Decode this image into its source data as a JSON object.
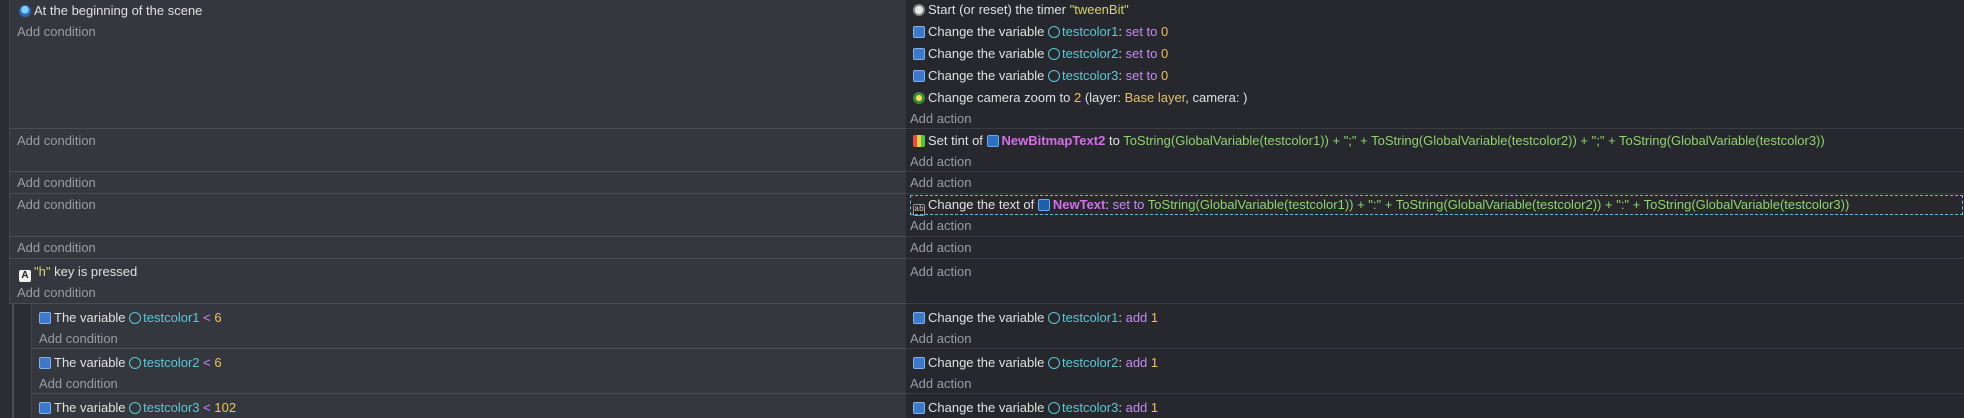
{
  "labels": {
    "add_condition": "Add condition",
    "add_action": "Add action",
    "change_variable": "Change the variable",
    "the_variable": "The variable",
    "set_to": "set to",
    "add": "add"
  },
  "event1": {
    "condition": "At the beginning of the scene",
    "timer_action": "Start (or reset) the timer",
    "timer_name": "\"tweenBit\"",
    "vars": [
      {
        "name": "testcolor1",
        "value": "0"
      },
      {
        "name": "testcolor2",
        "value": "0"
      },
      {
        "name": "testcolor3",
        "value": "0"
      }
    ],
    "zoom_text": "Change camera zoom to",
    "zoom_value": "2",
    "zoom_layer_label": "(layer:",
    "zoom_layer": "Base layer",
    "zoom_camera_label": ", camera: )"
  },
  "event2": {
    "tint_text": "Set tint of",
    "object": "NewBitmapText2",
    "to": "to",
    "expression": "ToString(GlobalVariable(testcolor1)) + \";\" + ToString(GlobalVariable(testcolor2)) + \";\" + ToString(GlobalVariable(testcolor3))"
  },
  "event4": {
    "text_action": "Change the text of",
    "object": "NewText",
    "expression": "ToString(GlobalVariable(testcolor1)) + \":\" + ToString(GlobalVariable(testcolor2)) + \":\" + ToString(GlobalVariable(testcolor3))"
  },
  "event6": {
    "key": "\"h\"",
    "key_text": "key is pressed"
  },
  "subevents": [
    {
      "var": "testcolor1",
      "op": "<",
      "value": "6",
      "add": "1"
    },
    {
      "var": "testcolor2",
      "op": "<",
      "value": "6",
      "add": "1"
    },
    {
      "var": "testcolor3",
      "op": "<",
      "value": "102",
      "add": "1"
    }
  ]
}
